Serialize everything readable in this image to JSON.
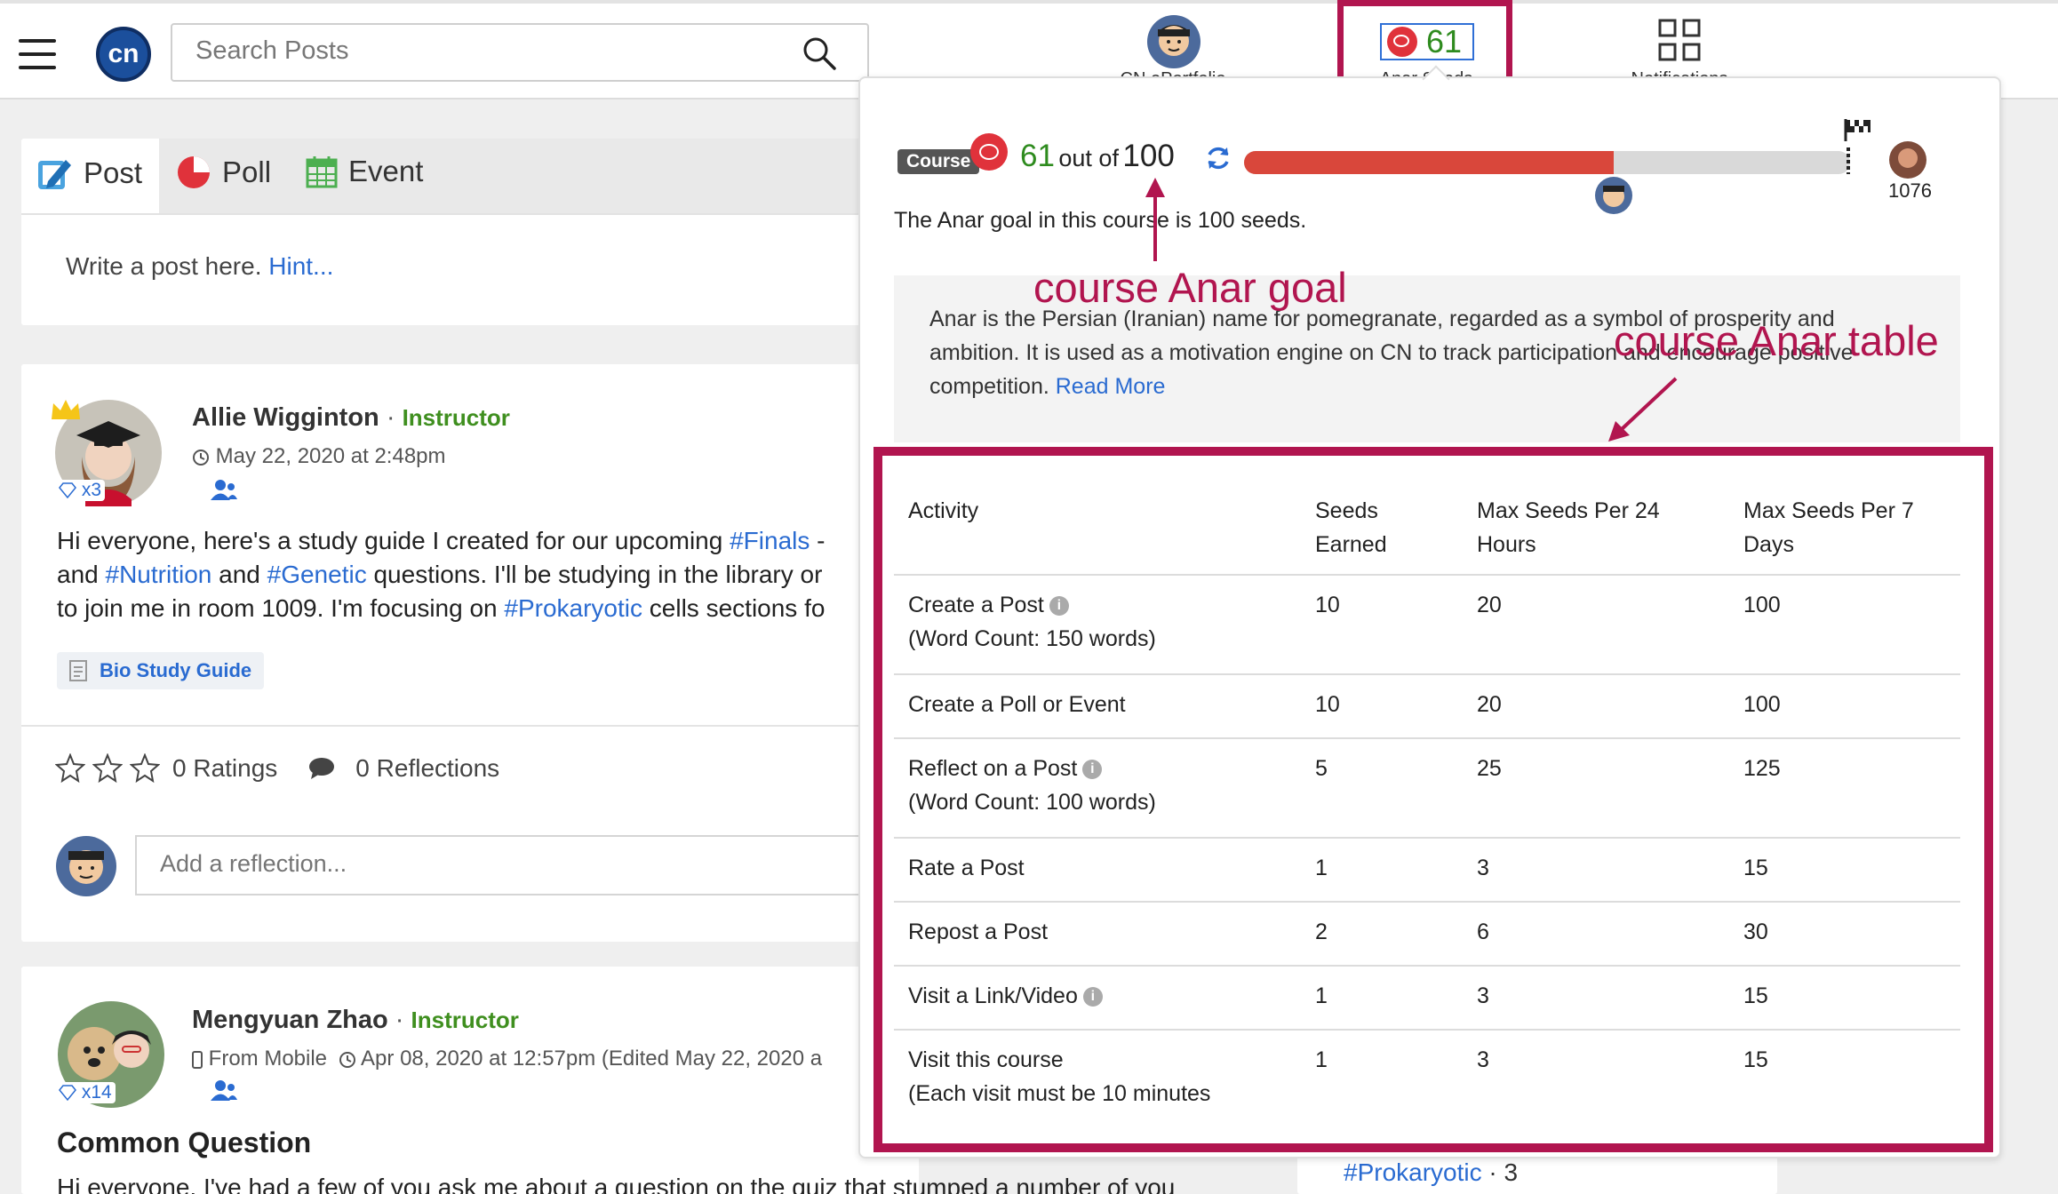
{
  "header": {
    "search_placeholder": "Search Posts",
    "logo_text": "cn",
    "nav": [
      {
        "label": "CN ePortfolio"
      },
      {
        "label": "Anar Seeds",
        "count": "61"
      },
      {
        "label": "Notifications"
      }
    ]
  },
  "composer": {
    "tabs": [
      {
        "label": "Post"
      },
      {
        "label": "Poll"
      },
      {
        "label": "Event"
      }
    ],
    "prompt": "Write a post here.",
    "hint": "Hint..."
  },
  "posts": [
    {
      "author": "Allie Wigginton",
      "role": "Instructor",
      "date": "May 22, 2020 at 2:48pm",
      "badge": "x3",
      "lines": [
        [
          "Hi everyone, here's a study guide I created for our upcoming ",
          "#Finals",
          " -",
          "",
          ""
        ],
        [
          "and ",
          "#Nutrition",
          " and ",
          "#Genetic",
          " questions. I'll be studying in the library or"
        ],
        [
          "to join me in room 1009. I'm focusing on ",
          "#Prokaryotic",
          " cells sections fo",
          "",
          ""
        ]
      ],
      "attachment": "Bio Study Guide",
      "ratings": "0 Ratings",
      "reflections": "0 Reflections",
      "reflection_placeholder": "Add a reflection..."
    },
    {
      "author": "Mengyuan Zhao",
      "role": "Instructor",
      "source": "From Mobile",
      "date": "Apr 08, 2020 at 12:57pm (Edited May 22, 2020 a",
      "badge": "x14",
      "title": "Common Question",
      "text": "Hi everyone, I've had a few of you ask me about a question on the quiz that stumped a number of you"
    }
  ],
  "sidebar_tag": {
    "tag": "#Prokaryotic",
    "count": "· 3"
  },
  "popup": {
    "course_badge": "Course",
    "seeds": "61",
    "out_of": "out of",
    "goal": "100",
    "progress": 0.61,
    "leader_score": "1076",
    "goal_text_prefix": "The Anar goal in this course is ",
    "goal_text_value": "100 seeds.",
    "info_lines": [
      "Anar is the Persian (Iranian) name for pomegranate, regarded as a symbol of prosperity and",
      "ambition. It is used as a motivation engine on CN to track participation and encourage positive",
      "competition."
    ],
    "read_more": "Read More",
    "table": {
      "headers": [
        "Activity",
        "Seeds Earned",
        "Max Seeds Per 24 Hours",
        "Max Seeds Per 7 Days"
      ],
      "rows": [
        {
          "activity": "Create a Post",
          "note": "(Word Count: 150 words)",
          "info": true,
          "seeds": "10",
          "h24": "20",
          "d7": "100"
        },
        {
          "activity": "Create a Poll or Event",
          "note": "",
          "info": false,
          "seeds": "10",
          "h24": "20",
          "d7": "100"
        },
        {
          "activity": "Reflect on a Post",
          "note": "(Word Count: 100 words)",
          "info": true,
          "seeds": "5",
          "h24": "25",
          "d7": "125"
        },
        {
          "activity": "Rate a Post",
          "note": "",
          "info": false,
          "seeds": "1",
          "h24": "3",
          "d7": "15"
        },
        {
          "activity": "Repost a Post",
          "note": "",
          "info": false,
          "seeds": "2",
          "h24": "6",
          "d7": "30"
        },
        {
          "activity": "Visit a Link/Video",
          "note": "",
          "info": true,
          "seeds": "1",
          "h24": "3",
          "d7": "15"
        },
        {
          "activity": "Visit this course",
          "note": "(Each visit must be 10 minutes",
          "info": false,
          "seeds": "1",
          "h24": "3",
          "d7": "15"
        }
      ]
    }
  },
  "annotations": {
    "goal": "course Anar goal",
    "table": "course Anar table"
  },
  "colors": {
    "accent": "#b1154f",
    "link": "#2a6bd1",
    "seed_green": "#2e8b1e",
    "progress_red": "#d9473b",
    "instructor_green": "#3f8f1f"
  }
}
